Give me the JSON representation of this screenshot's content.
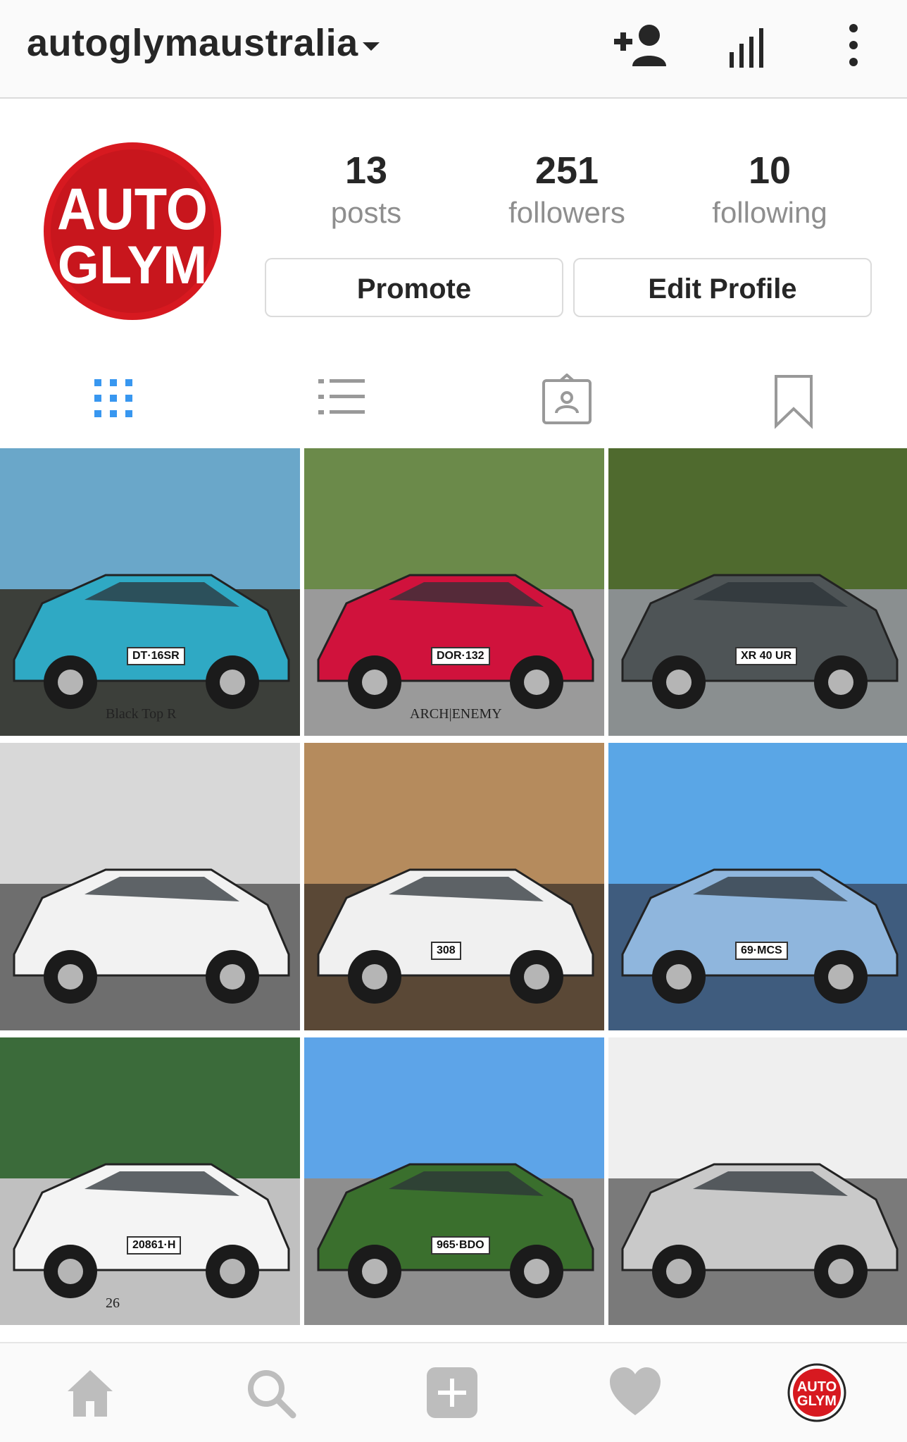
{
  "header": {
    "username": "autoglymaustralia",
    "icons": [
      "caret-down-icon",
      "add-person-icon",
      "insights-icon",
      "more-vertical-icon"
    ]
  },
  "profile": {
    "avatar_text_line1": "AUTO",
    "avatar_text_line2": "GLYM",
    "stats": [
      {
        "value": "13",
        "label": "posts"
      },
      {
        "value": "251",
        "label": "followers"
      },
      {
        "value": "10",
        "label": "following"
      }
    ],
    "buttons": {
      "promote": "Promote",
      "edit": "Edit Profile"
    }
  },
  "tabs": [
    "grid-icon",
    "list-icon",
    "tagged-icon",
    "bookmark-icon"
  ],
  "posts": [
    {
      "name": "blue-datsun-post",
      "colors": [
        "#6aa7c9",
        "#2fa9c4",
        "#3c3f3a"
      ],
      "plate": "DT·16SR",
      "caption": "Black Top R"
    },
    {
      "name": "red-skyline-post",
      "colors": [
        "#6b8a4a",
        "#d0123c",
        "#9a9a9a"
      ],
      "plate": "DOR·132",
      "caption": "ARCH|ENEMY"
    },
    {
      "name": "grey-fiesta-post",
      "colors": [
        "#4f6a2e",
        "#4e5456",
        "#8a8f90"
      ],
      "plate": "XR 40 UR",
      "caption": ""
    },
    {
      "name": "white-monaro-post",
      "colors": [
        "#d8d8d8",
        "#f2f2f2",
        "#6e6e6e"
      ],
      "plate": "",
      "caption": ""
    },
    {
      "name": "white-torana-post",
      "colors": [
        "#b58b5d",
        "#f0f0f0",
        "#5a4836"
      ],
      "plate": "308",
      "caption": ""
    },
    {
      "name": "blue-mini-post",
      "colors": [
        "#5aa6e6",
        "#8fb6dd",
        "#3f5c7e"
      ],
      "plate": "69·MCS",
      "caption": ""
    },
    {
      "name": "white-bmw-post",
      "colors": [
        "#3b6b3a",
        "#f4f4f4",
        "#c0c0c0"
      ],
      "plate": "20861·H",
      "caption": "26"
    },
    {
      "name": "blue-commodore-post",
      "colors": [
        "#5da4e8",
        "#3a6f2d",
        "#8e8e8e"
      ],
      "plate": "965·BDO",
      "caption": ""
    },
    {
      "name": "silver-integra-post",
      "colors": [
        "#efefef",
        "#c9c9c9",
        "#7a7a7a"
      ],
      "plate": "",
      "caption": ""
    }
  ],
  "bottom_nav": [
    "home-icon",
    "search-icon",
    "new-post-icon",
    "activity-heart-icon",
    "profile-avatar-icon"
  ],
  "colors": {
    "brand_red": "#d71920",
    "active_tab": "#3897f0",
    "icon_grey": "#999999",
    "text": "#262626",
    "muted": "#8e8e8e"
  }
}
